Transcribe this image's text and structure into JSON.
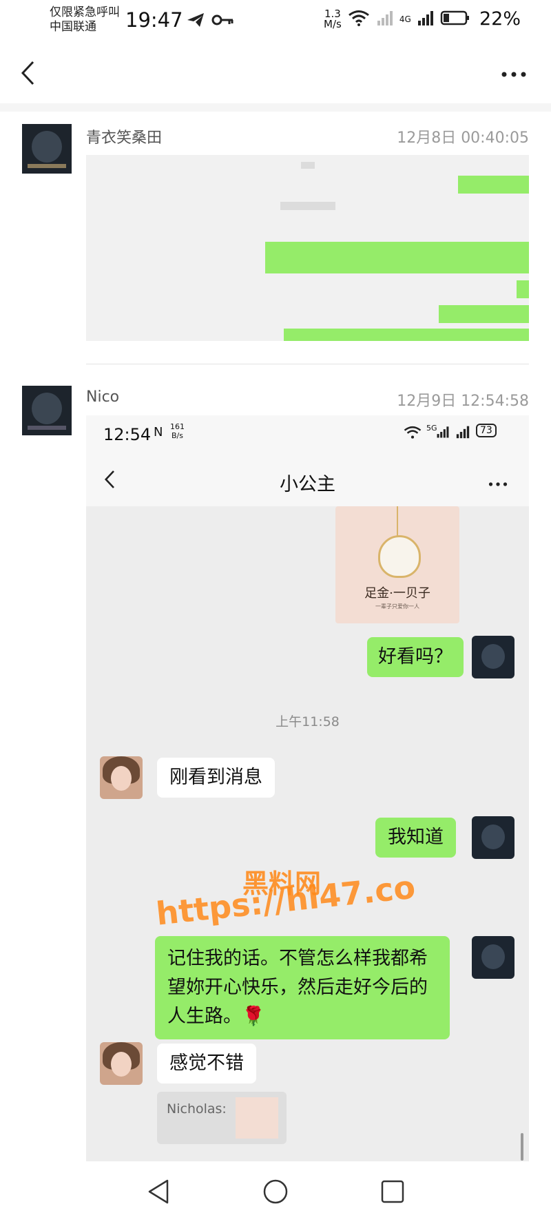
{
  "status_bar": {
    "carrier_line1": "仅限紧急呼叫",
    "carrier_line2": "中国联通",
    "time": "19:47",
    "net_speed_value": "1.3",
    "net_speed_unit": "M/s",
    "network": "4G",
    "battery": "22%"
  },
  "posts": [
    {
      "name": "青衣笑桑田",
      "time": "12月8日 00:40:05"
    },
    {
      "name": "Nico",
      "time": "12月9日 12:54:58",
      "screenshot": {
        "status_time": "12:54",
        "net_speed_value": "161",
        "net_speed_unit": "B/s",
        "network": "5G",
        "battery": "73",
        "title": "小公主",
        "product_title": "足金·一贝子",
        "product_sub": "一辈子只爱你一人",
        "messages": [
          {
            "from": "me",
            "text": "好看吗？"
          },
          {
            "type": "time",
            "text": "上午11:58"
          },
          {
            "from": "her",
            "text": "刚看到消息"
          },
          {
            "from": "me",
            "text": "我知道"
          },
          {
            "from": "me",
            "text": "记住我的话。不管怎么样我都希望妳开心快乐，然后走好今后的人生路。🌹"
          },
          {
            "from": "her",
            "text": "感觉不错"
          },
          {
            "from": "her",
            "type": "quote",
            "text": "Nicholas:"
          }
        ]
      }
    }
  ],
  "watermark": {
    "line1": "黑料网",
    "line2": "https://hl47.co"
  },
  "colors": {
    "bubble_green": "#95ec69",
    "chat_bg": "#ededed",
    "watermark": "#ff8a1a"
  },
  "icons": [
    "back-icon",
    "more-icon",
    "wifi-icon",
    "signal-icon",
    "battery-icon",
    "nav-back-icon",
    "nav-home-icon",
    "nav-recents-icon"
  ]
}
